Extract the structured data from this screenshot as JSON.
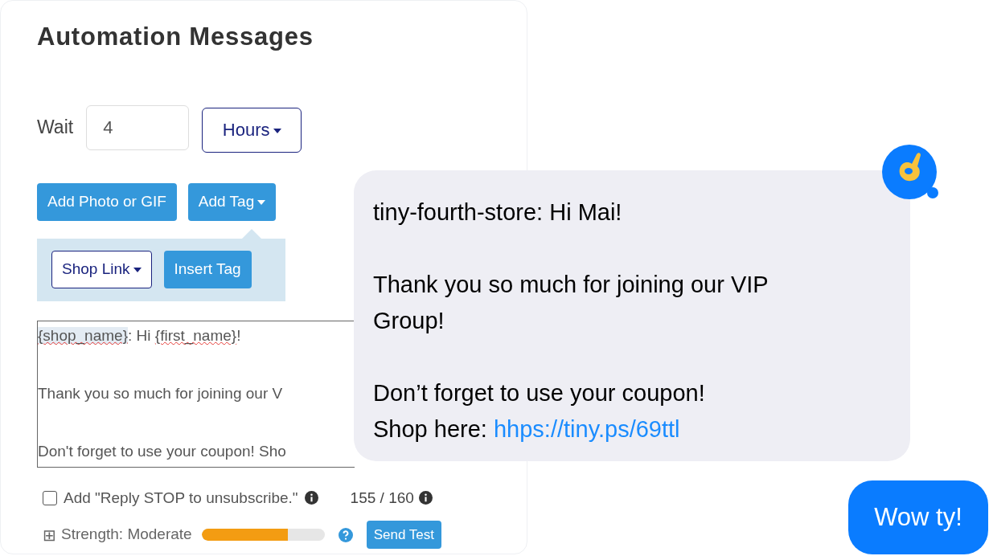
{
  "panel": {
    "title": "Automation Messages",
    "wait": {
      "label": "Wait",
      "value": "4",
      "unit": "Hours"
    },
    "buttons": [
      "Add Photo or GIF",
      "Add Tag"
    ],
    "tag_panel": {
      "select": "Shop Link",
      "button": "Insert Tag"
    },
    "message_lines": [
      [
        {
          "text": "{shop_name}",
          "misspelled": true,
          "highlighted": true
        },
        {
          "text": ": Hi ",
          "misspelled": false,
          "highlighted": false
        },
        {
          "text": "{first_name}",
          "misspelled": true,
          "highlighted": false
        },
        {
          "text": "!",
          "misspelled": false,
          "highlighted": false
        }
      ],
      "Thank you so much for joining our V",
      "Don't forget to use your coupon! Sho"
    ],
    "stop_option": {
      "label": "Add \"Reply STOP to unsubscribe.\"",
      "checked": false
    },
    "counter": "155 / 160",
    "strength": {
      "expander": "⊞",
      "label": "Strength: Moderate",
      "level": 0.7
    },
    "send_button": "Send Test"
  },
  "incoming_message": {
    "paragraphs": [
      {
        "text": "tiny-fourth-store: Hi Mai!"
      },
      {
        "text": "Thank you so much for joining our VIP Group!"
      },
      {
        "text": "Don’t forget to use your coupon!",
        "link_prefix": "Shop here: ",
        "link": "hhps://tiny.ps/69ttl"
      }
    ]
  },
  "reply_message": "Wow ty!"
}
